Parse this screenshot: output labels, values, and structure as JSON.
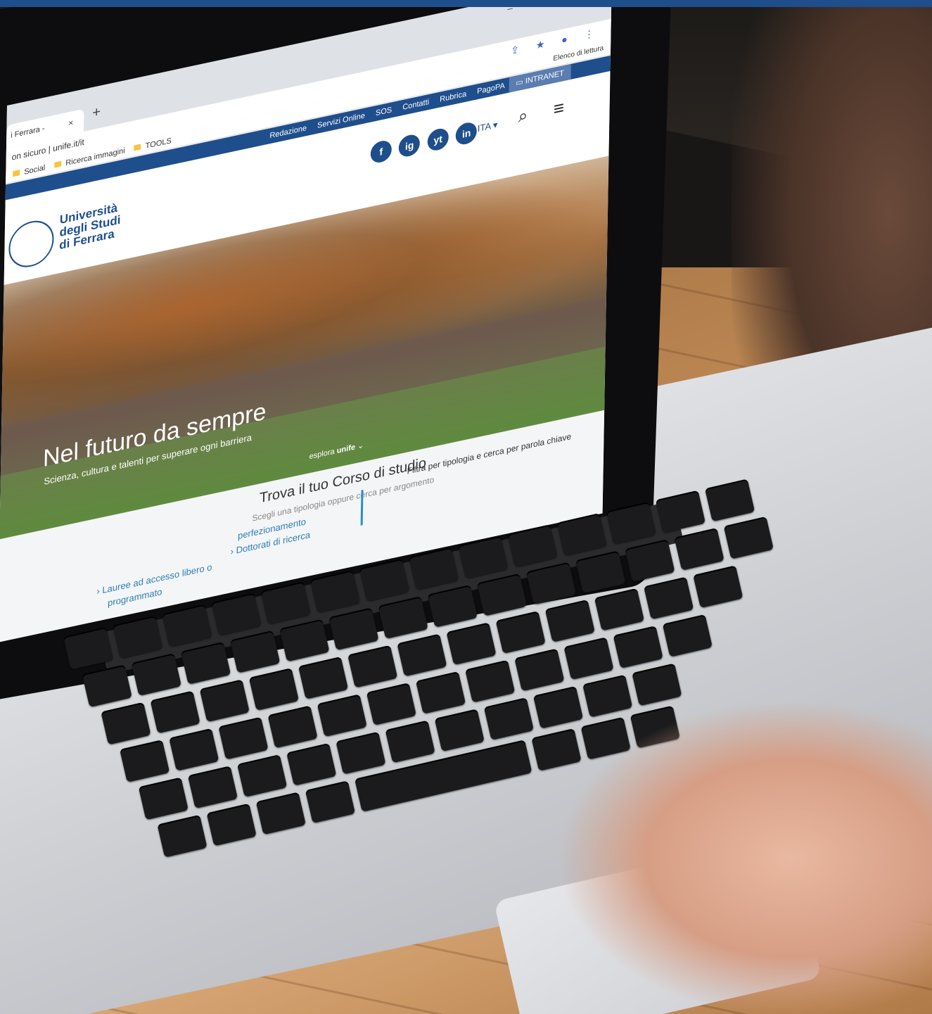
{
  "browser": {
    "tab_title": "i Ferrara -",
    "tab_close": "×",
    "new_tab": "+",
    "window_controls": "–  ▢  ✕",
    "address": "on sicuro | unife.it/it",
    "bookmarks": [
      "Social",
      "Ricerca immagini",
      "TOOLS"
    ],
    "reading_list": "Elenco di lettura"
  },
  "site": {
    "nav_links": [
      "Redazione",
      "Servizi Online",
      "SOS",
      "Contatti",
      "Rubrica",
      "PagoPA"
    ],
    "intranet": "INTRANET",
    "logo_lines": [
      "Università",
      "degli Studi",
      "di Ferrara"
    ],
    "socials": [
      "f",
      "ig",
      "yt",
      "in"
    ],
    "lang": "ITA ▾",
    "hero": {
      "title": "Nel futuro da sempre",
      "subtitle": "Scienza, cultura e talenti per superare ogni barriera",
      "explore_prefix": "esplora",
      "explore_brand": "unife"
    },
    "courses": {
      "title": "Trova il tuo Corso di studio",
      "subtitle": "Scegli una tipologia oppure cerca per argomento",
      "filter": "Filtra per tipologia e cerca per parola chiave",
      "links": [
        "perfezionamento",
        "› Dottorati di ricerca",
        "› Lauree ad accesso libero o",
        "programmato"
      ]
    }
  },
  "colors": {
    "brand": "#1f4e8c",
    "accent": "#2a8fc5"
  }
}
